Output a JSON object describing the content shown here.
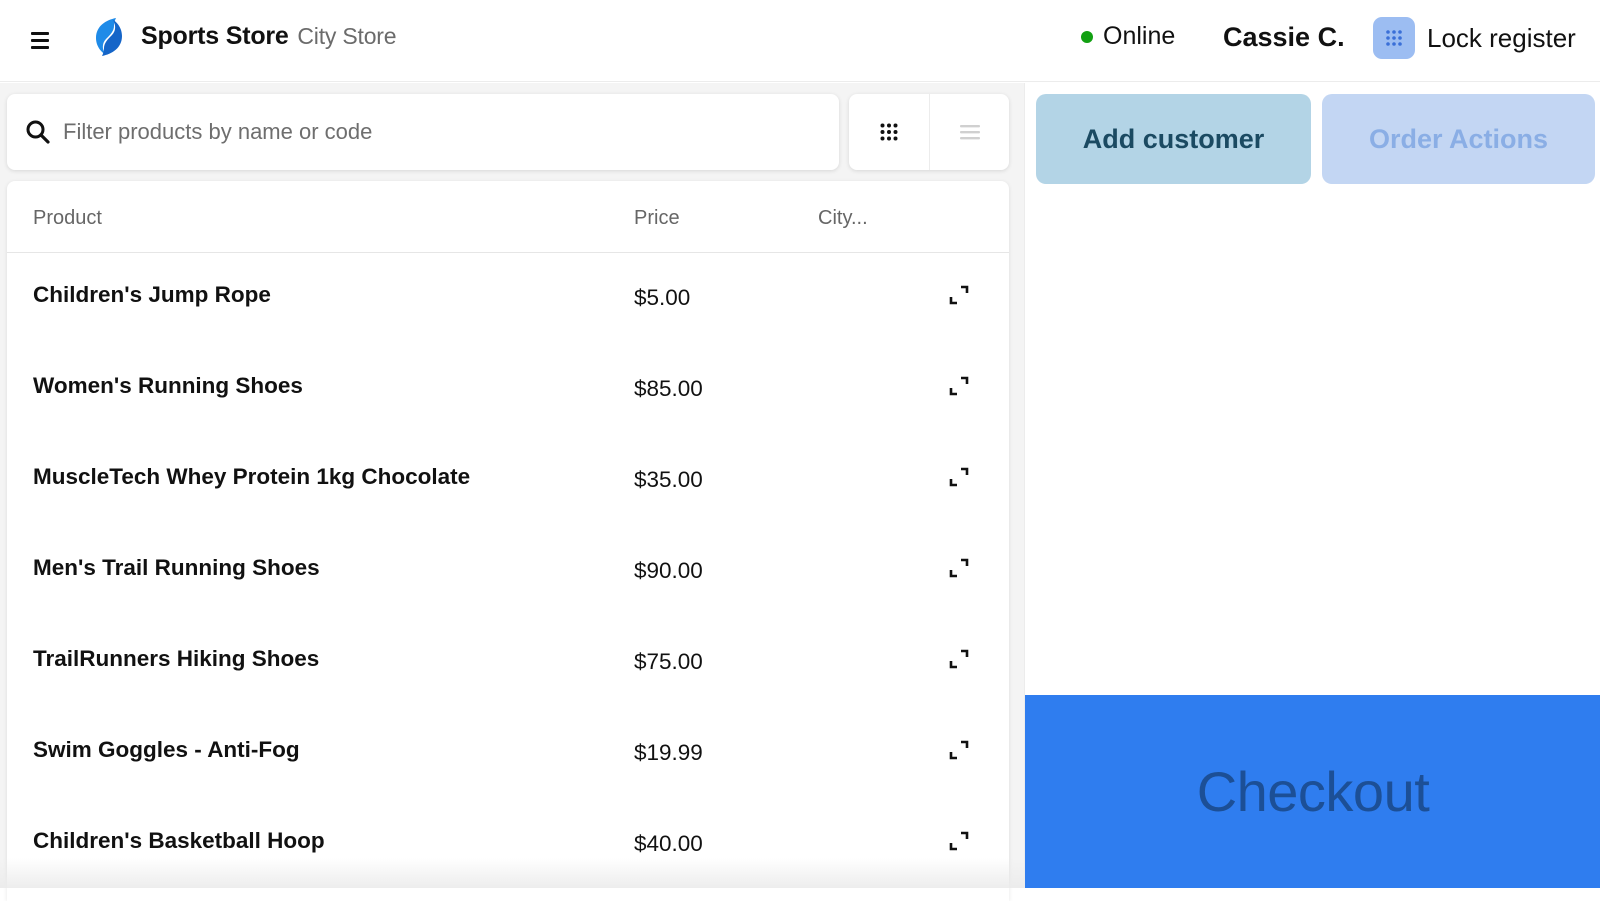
{
  "header": {
    "menu_icon": "hamburger-menu-icon",
    "logo_icon": "sports-store-logo-icon",
    "store_name": "Sports Store",
    "store_location": "City Store",
    "status_label": "Online",
    "status_color": "#12a012",
    "cashier_name": "Cassie C.",
    "lock_icon": "grid-dots-icon",
    "lock_label": "Lock register"
  },
  "search": {
    "placeholder": "Filter products by name or code",
    "value": "",
    "icon": "search-icon"
  },
  "view_toggle": {
    "grid_icon": "grid-view-icon",
    "list_icon": "list-view-icon",
    "active": "grid"
  },
  "table": {
    "headers": {
      "product": "Product",
      "price": "Price",
      "city": "City..."
    },
    "rows": [
      {
        "name": "Children's Jump Rope",
        "price": "$5.00"
      },
      {
        "name": "Women's Running Shoes",
        "price": "$85.00"
      },
      {
        "name": "MuscleTech Whey Protein 1kg Chocolate",
        "price": "$35.00"
      },
      {
        "name": "Men's Trail Running Shoes",
        "price": "$90.00"
      },
      {
        "name": "TrailRunners Hiking Shoes",
        "price": "$75.00"
      },
      {
        "name": "Swim Goggles - Anti-Fog",
        "price": "$19.99"
      },
      {
        "name": "Children's Basketball Hoop",
        "price": "$40.00"
      }
    ],
    "row_action_icon": "expand-icon"
  },
  "order_panel": {
    "add_customer_label": "Add customer",
    "order_actions_label": "Order Actions",
    "checkout_label": "Checkout"
  },
  "colors": {
    "accent_blue": "#2f7def",
    "add_customer_bg": "#b3d4e6",
    "order_actions_bg": "#c3d6f3",
    "lock_icon_bg": "#9cbdf2"
  }
}
